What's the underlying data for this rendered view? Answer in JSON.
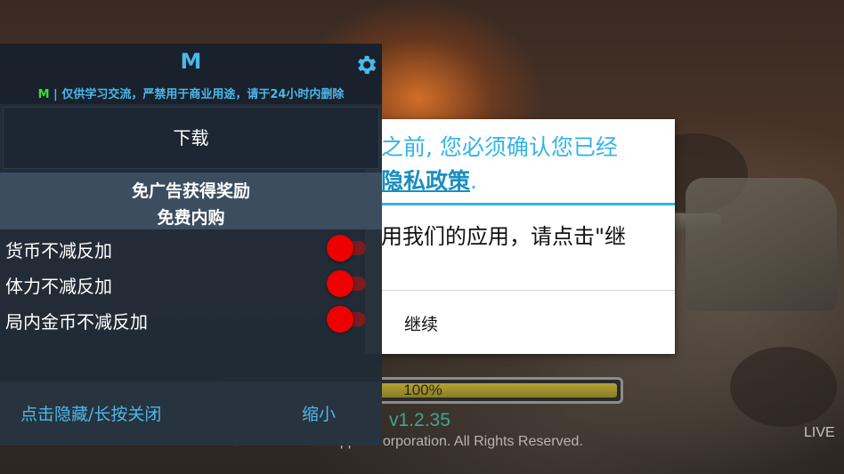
{
  "game": {
    "progress_text": "100%",
    "progress_value": 1.0,
    "version": "v1.2.35",
    "copyright": "© MOBIRIX & Hopper Corporation. All Rights Reserved.",
    "live_badge": "LIVE"
  },
  "dialog": {
    "line1": "之前, 您必须确认您已经",
    "link_text": "隐私政策",
    "link_suffix": ".",
    "body": "用我们的应用，请点击\"继",
    "continue_label": "继续"
  },
  "mod_menu": {
    "title": "M",
    "notice_prefix": "M",
    "notice_text": " | 仅供学习交流，严禁用于商业用途，请于24小时内删除",
    "download_label": "下载",
    "section_line1": "免广告获得奖励",
    "section_line2": "免费内购",
    "toggles": [
      {
        "label": "货币不减反加",
        "state": "on"
      },
      {
        "label": "体力不减反加",
        "state": "on"
      },
      {
        "label": "局内金币不减反加",
        "state": "on"
      }
    ],
    "footer_hide_label": "点击隐藏/长按关闭",
    "footer_minimize_label": "缩小",
    "colors": {
      "accent": "#4cb8e8",
      "notice_m": "#3ddc3d",
      "toggle_on": "#ee0000"
    }
  }
}
